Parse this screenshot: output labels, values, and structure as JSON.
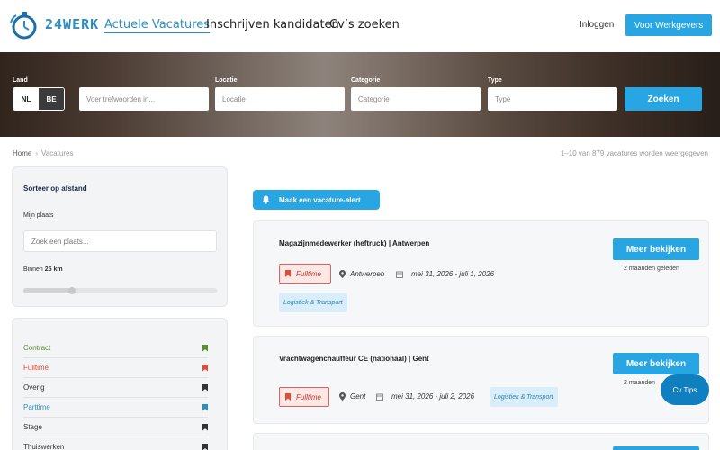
{
  "header": {
    "logo_text": "24WERK",
    "nav": [
      "Actuele Vacatures",
      "Inschrijven kandidaten",
      "Cv’s zoeken"
    ],
    "login": "Inloggen",
    "employers_button": "Voor Werkgevers"
  },
  "search": {
    "land_label": "Land",
    "land_options": [
      "NL",
      "BE"
    ],
    "keywords_placeholder": "Voer trefwoorden in...",
    "location_label": "Locatie",
    "location_placeholder": "Locatie",
    "category_label": "Categorie",
    "category_placeholder": "Categorie",
    "type_label": "Type",
    "type_placeholder": "Type",
    "submit": "Zoeken"
  },
  "breadcrumb": {
    "home": "Home",
    "current": "Vacatures"
  },
  "results_text": "1–10 van 879 vacatures worden weergegeven",
  "sidebar": {
    "sort_title": "Sorteer op afstand",
    "my_place_label": "Mijn plaats",
    "place_placeholder": "Zoek een plaats...",
    "within_label": "Binnen",
    "within_value": "25 km",
    "distance_fraction": 0.25,
    "job_types": [
      {
        "label": "Contract",
        "color": "#5a8f2e"
      },
      {
        "label": "Fulltime",
        "color": "#e04b3a"
      },
      {
        "label": "Overig",
        "color": "#333333"
      },
      {
        "label": "Parttime",
        "color": "#2a8fc7"
      },
      {
        "label": "Stage",
        "color": "#333333"
      },
      {
        "label": "Thuiswerken",
        "color": "#333333"
      }
    ]
  },
  "alert_button": "Maak een vacature-alert",
  "jobs": [
    {
      "title": "Magazijnmedewerker (heftruck) | Antwerpen",
      "type": "Fulltime",
      "location": "Antwerpen",
      "dates": "mei 31, 2026 - juli 1, 2026",
      "category": "Logistiek & Transport",
      "button": "Meer bekijken",
      "posted": "2 maanden geleden"
    },
    {
      "title": "Vrachtwagenchauffeur CE (nationaal) | Gent",
      "type": "Fulltime",
      "location": "Gent",
      "dates": "mei 31, 2026 - juli 2, 2026",
      "category": "Logistiek & Transport",
      "button": "Meer bekijken",
      "posted": "2 maanden"
    }
  ],
  "cv_tips": "Cv Tips",
  "colors": {
    "accent": "#27a6e3",
    "fulltime": "#e04b3a"
  }
}
